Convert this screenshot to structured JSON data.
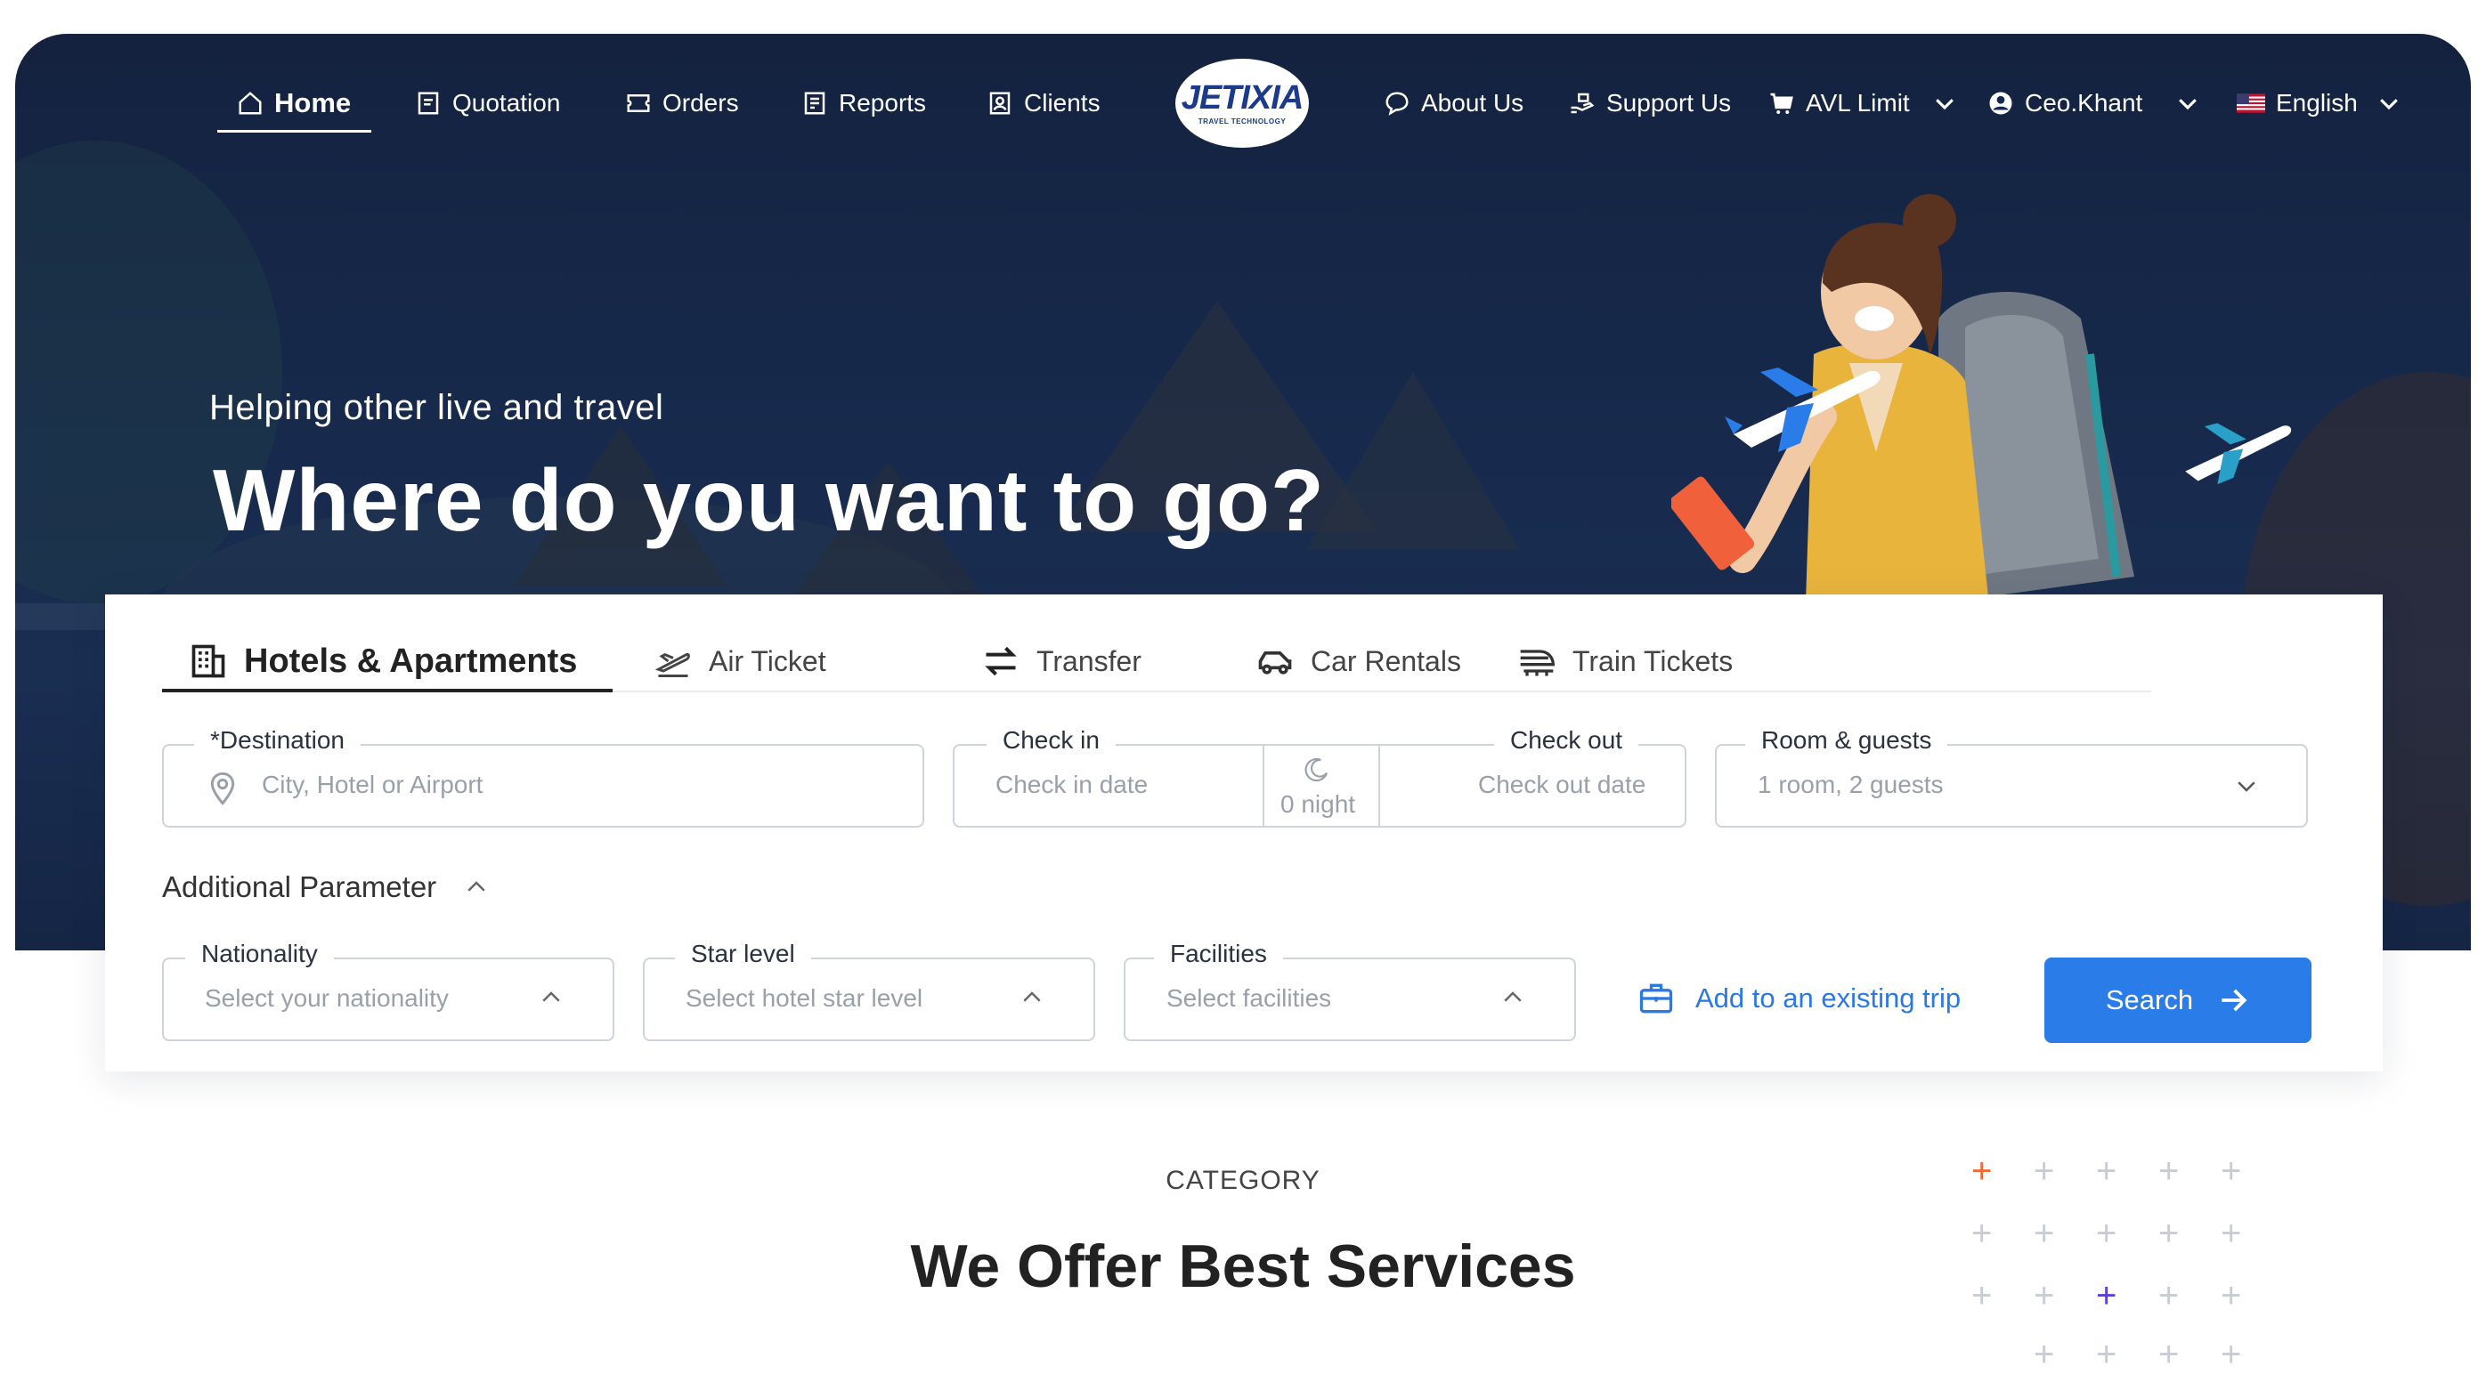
{
  "nav": {
    "home": "Home",
    "quotation": "Quotation",
    "orders": "Orders",
    "reports": "Reports",
    "clients": "Clients",
    "logo_text": "JETIXIA",
    "logo_sub": "TRAVEL TECHNOLOGY",
    "about": "About Us",
    "support": "Support Us",
    "avl": "AVL Limit",
    "user": "Ceo.Khant",
    "language": "English"
  },
  "hero": {
    "subtitle": "Helping other live and travel",
    "title": "Where do you want to go?"
  },
  "tabs": {
    "hotels": "Hotels & Apartments",
    "air": "Air Ticket",
    "transfer": "Transfer",
    "car": "Car Rentals",
    "train": "Train Tickets"
  },
  "form": {
    "destination_label": "*Destination",
    "destination_placeholder": "City, Hotel or Airport",
    "checkin_label": "Check in",
    "checkin_placeholder": "Check in date",
    "nights": "0 night",
    "checkout_label": "Check out",
    "checkout_placeholder": "Check out date",
    "rooms_label": "Room & guests",
    "rooms_value": "1 room, 2 guests",
    "additional": "Additional Parameter",
    "nationality_label": "Nationality",
    "nationality_placeholder": "Select your nationality",
    "star_label": "Star level",
    "star_placeholder": "Select hotel star level",
    "facilities_label": "Facilities",
    "facilities_placeholder": "Select facilities",
    "add_trip": "Add to an existing trip",
    "search": "Search"
  },
  "section": {
    "category": "CATEGORY",
    "title": "We Offer Best Services"
  },
  "colors": {
    "primary": "#2a7de8",
    "hero_bg": "#172a4d",
    "accent_orange": "#f06a3c",
    "accent_purple": "#5b3fd6"
  }
}
